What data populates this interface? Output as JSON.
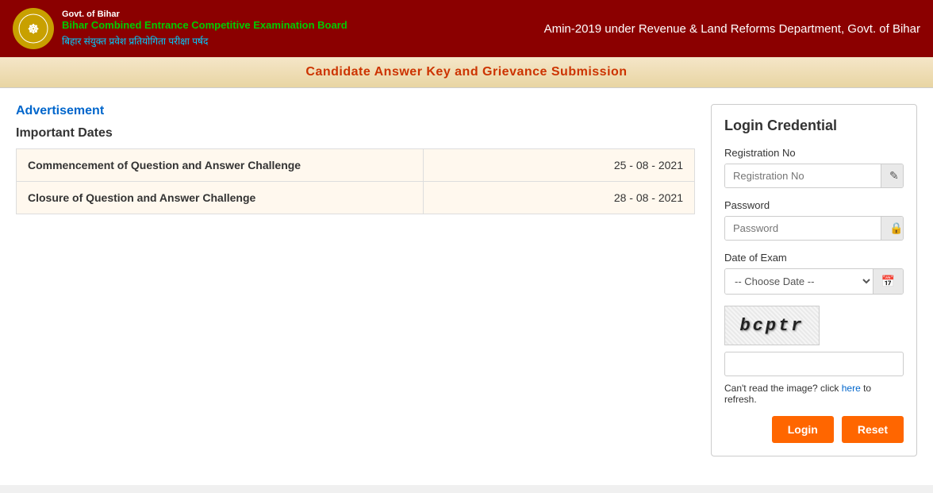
{
  "header": {
    "gov_line": "Govt. of Bihar",
    "board_name": "Bihar Combined Entrance Competitive Examination Board",
    "hindi_text": "बिहार संयुक्त प्रवेश प्रतियोगिता परीक्षा पर्षद",
    "page_title": "Amin-2019 under Revenue & Land Reforms Department, Govt. of Bihar"
  },
  "sub_header": {
    "title": "Candidate Answer Key and Grievance Submission"
  },
  "left": {
    "advertisement_label": "Advertisement",
    "important_dates_title": "Important Dates",
    "dates": [
      {
        "event": "Commencement of Question and Answer Challenge",
        "date": "25 - 08 - 2021"
      },
      {
        "event": "Closure of Question and Answer Challenge",
        "date": "28 - 08 - 2021"
      }
    ]
  },
  "login": {
    "title": "Login Credential",
    "reg_no_label": "Registration No",
    "reg_no_placeholder": "Registration No",
    "password_label": "Password",
    "password_placeholder": "Password",
    "date_of_exam_label": "Date of Exam",
    "date_of_exam_placeholder": "-- Choose Date --",
    "date_options": [
      "-- Choose Date --"
    ],
    "captcha_text": "bcptr",
    "captcha_refresh_text": "Can't read the image? click",
    "captcha_refresh_link": "here",
    "captcha_refresh_suffix": "to refresh.",
    "login_button": "Login",
    "reset_button": "Reset",
    "edit_icon": "✎",
    "lock_icon": "🔒",
    "calendar_icon": "📅"
  }
}
